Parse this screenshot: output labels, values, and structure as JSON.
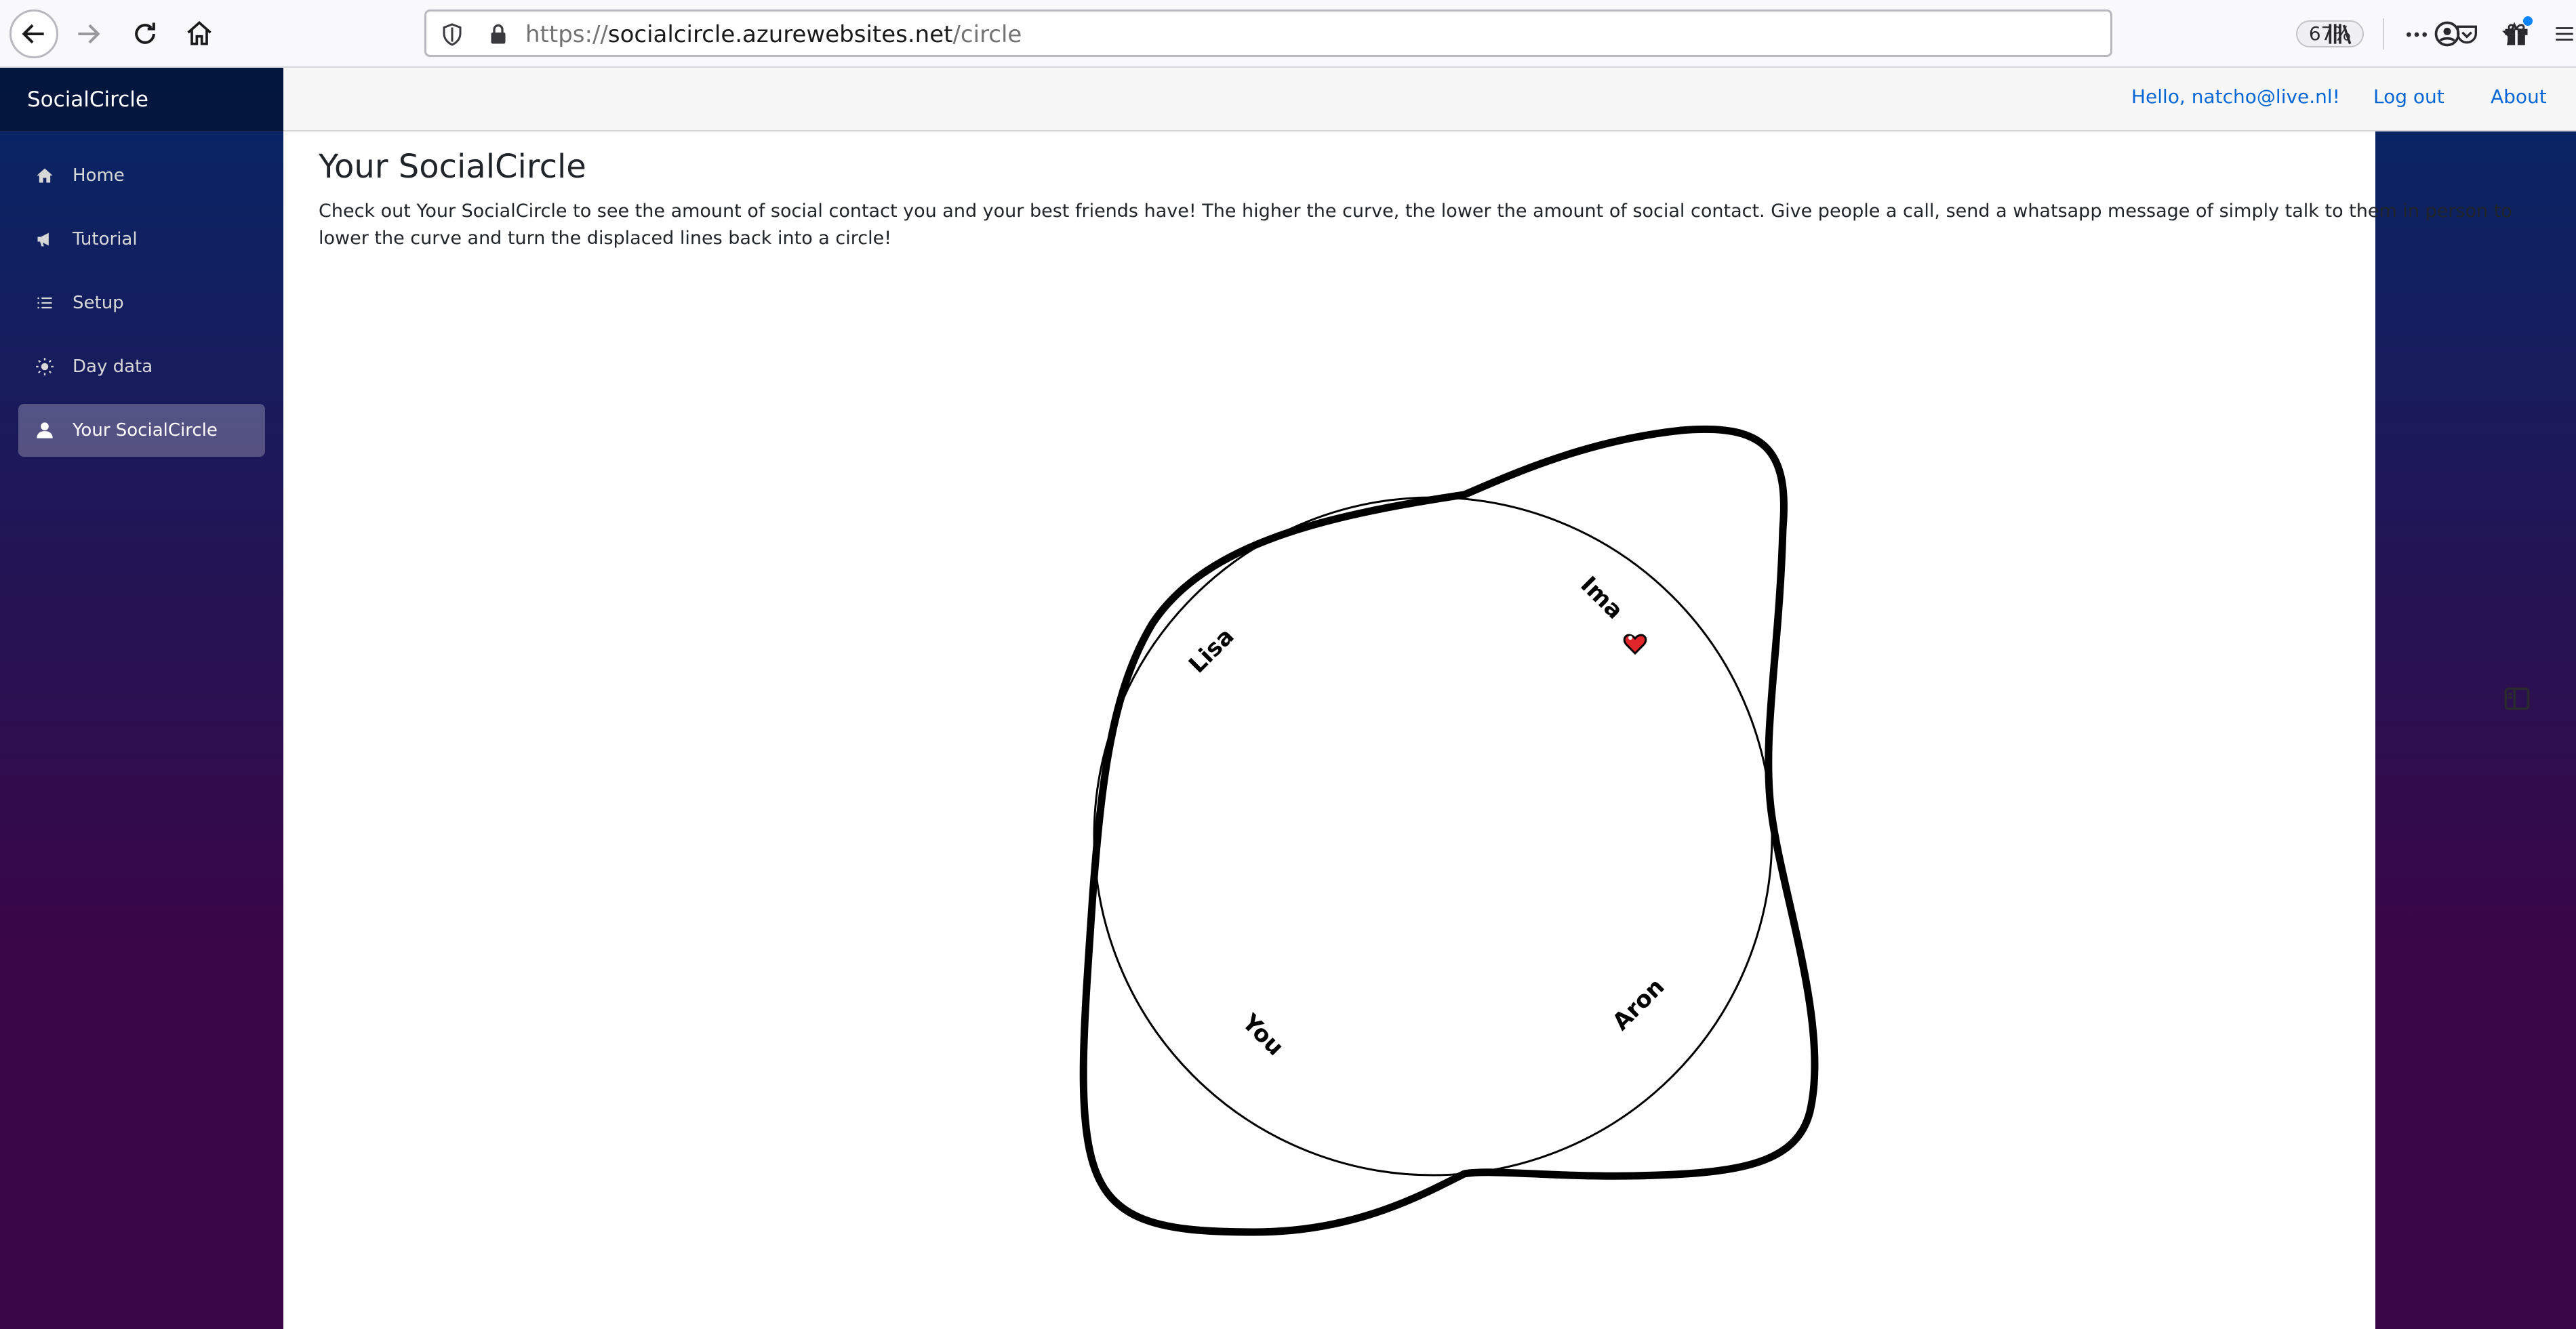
{
  "browser": {
    "url_prefix": "https://",
    "url_host": "socialcircle.azurewebsites.net",
    "url_path": "/circle",
    "zoom": "67%"
  },
  "sidebar": {
    "brand": "SocialCircle",
    "items": [
      {
        "label": "Home",
        "icon": "home-icon"
      },
      {
        "label": "Tutorial",
        "icon": "megaphone-icon"
      },
      {
        "label": "Setup",
        "icon": "list-icon"
      },
      {
        "label": "Day data",
        "icon": "sun-icon"
      },
      {
        "label": "Your SocialCircle",
        "icon": "person-icon",
        "active": true
      }
    ]
  },
  "top_row": {
    "hello": "Hello, natcho@live.nl!",
    "logout": "Log out",
    "about": "About"
  },
  "main": {
    "title": "Your SocialCircle",
    "description": "Check out Your SocialCircle to see the amount of social contact you and your best friends have! The higher the curve, the lower the amount of social contact. Give people a call, send a whatsapp message of simply talk to them in person to lower the curve and turn the displaced lines back into a circle!"
  },
  "circle": {
    "names": [
      "Lisa",
      "Ima",
      "You",
      "Aron"
    ],
    "heart_icon": "heart-icon",
    "colors": {
      "curve": "#000000",
      "heart": "#e0262b"
    }
  },
  "colors": {
    "link": "#0366d6",
    "sidebar_top": "#052767",
    "sidebar_bottom": "#3a0647"
  }
}
